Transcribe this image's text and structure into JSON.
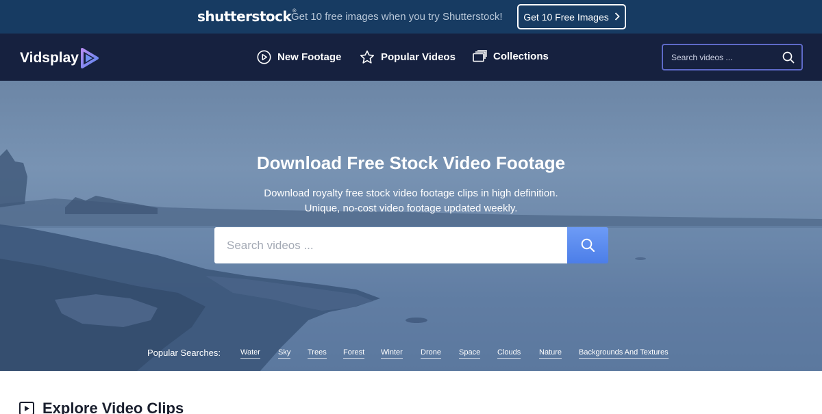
{
  "promo": {
    "logo": "shutterstock",
    "text": "Get 10 free images when you try Shutterstock!",
    "button_label": "Get 10 Free Images"
  },
  "nav": {
    "brand": "Vidsplay",
    "items": [
      {
        "label": "New Footage",
        "icon": "play-circle-icon"
      },
      {
        "label": "Popular Videos",
        "icon": "star-icon"
      },
      {
        "label": "Collections",
        "icon": "collections-icon"
      }
    ],
    "search_placeholder": "Search videos ..."
  },
  "hero": {
    "title": "Download Free Stock Video Footage",
    "subtitle_line1": "Download royalty free stock video footage clips in high definition.",
    "subtitle_line2": "Unique, no-cost video footage updated weekly.",
    "search_placeholder": "Search videos ...",
    "popular_label": "Popular Searches:",
    "popular_tags": [
      "Water",
      "Sky",
      "Trees",
      "Forest",
      "Winter",
      "Drone",
      "Space",
      "Clouds",
      "Nature",
      "Backgrounds And Textures"
    ]
  },
  "explore": {
    "title": "Explore Video Clips"
  },
  "colors": {
    "promo_bg": "#173b62",
    "nav_bg": "#16213f",
    "accent": "#4c7ee8",
    "search_border": "#5e6ac8"
  }
}
